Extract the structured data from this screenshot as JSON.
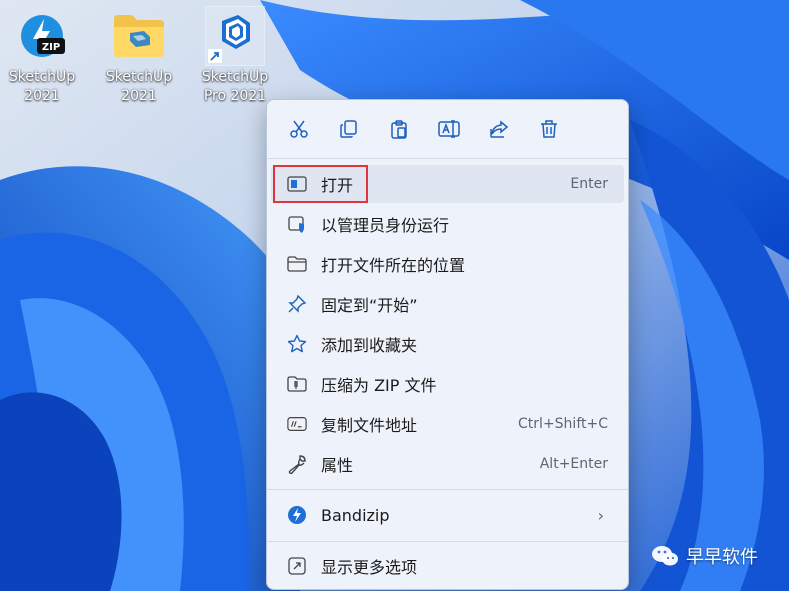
{
  "desktop": {
    "icons": [
      {
        "label_line1": "SketchUp",
        "label_line2": "2021",
        "icon": "zip-archive-icon",
        "badge": "ZIP"
      },
      {
        "label_line1": "SketchUp",
        "label_line2": "2021",
        "icon": "folder-icon"
      },
      {
        "label_line1": "SketchUp",
        "label_line2": "Pro 2021",
        "icon": "sketchup-icon",
        "shortcut": true
      }
    ]
  },
  "context_menu": {
    "toolbar": [
      {
        "name": "cut",
        "icon": "scissors-icon"
      },
      {
        "name": "copy",
        "icon": "copy-icon"
      },
      {
        "name": "paste",
        "icon": "paste-icon"
      },
      {
        "name": "rename",
        "icon": "rename-icon"
      },
      {
        "name": "share",
        "icon": "share-icon"
      },
      {
        "name": "delete",
        "icon": "trash-icon"
      }
    ],
    "items": [
      {
        "label": "打开",
        "shortcut": "Enter",
        "icon": "open-window-icon",
        "highlighted": true
      },
      {
        "label": "以管理员身份运行",
        "shortcut": "",
        "icon": "admin-shield-icon"
      },
      {
        "label": "打开文件所在的位置",
        "shortcut": "",
        "icon": "folder-outline-icon"
      },
      {
        "label": "固定到“开始”",
        "shortcut": "",
        "icon": "pin-icon"
      },
      {
        "label": "添加到收藏夹",
        "shortcut": "",
        "icon": "star-icon"
      },
      {
        "label": "压缩为 ZIP 文件",
        "shortcut": "",
        "icon": "zip-folder-icon"
      },
      {
        "label": "复制文件地址",
        "shortcut": "Ctrl+Shift+C",
        "icon": "copy-path-icon"
      },
      {
        "label": "属性",
        "shortcut": "Alt+Enter",
        "icon": "wrench-icon"
      }
    ],
    "bandizip": {
      "label": "Bandizip",
      "icon": "bandizip-icon",
      "chevron": "›"
    },
    "more": {
      "label": "显示更多选项",
      "icon": "show-more-icon"
    }
  },
  "watermark": {
    "text": "早早软件",
    "icon": "wechat-icon"
  },
  "colors": {
    "accent": "#0a63d8",
    "highlight_box": "#e0353a",
    "menu_bg": "#eef3fb"
  }
}
